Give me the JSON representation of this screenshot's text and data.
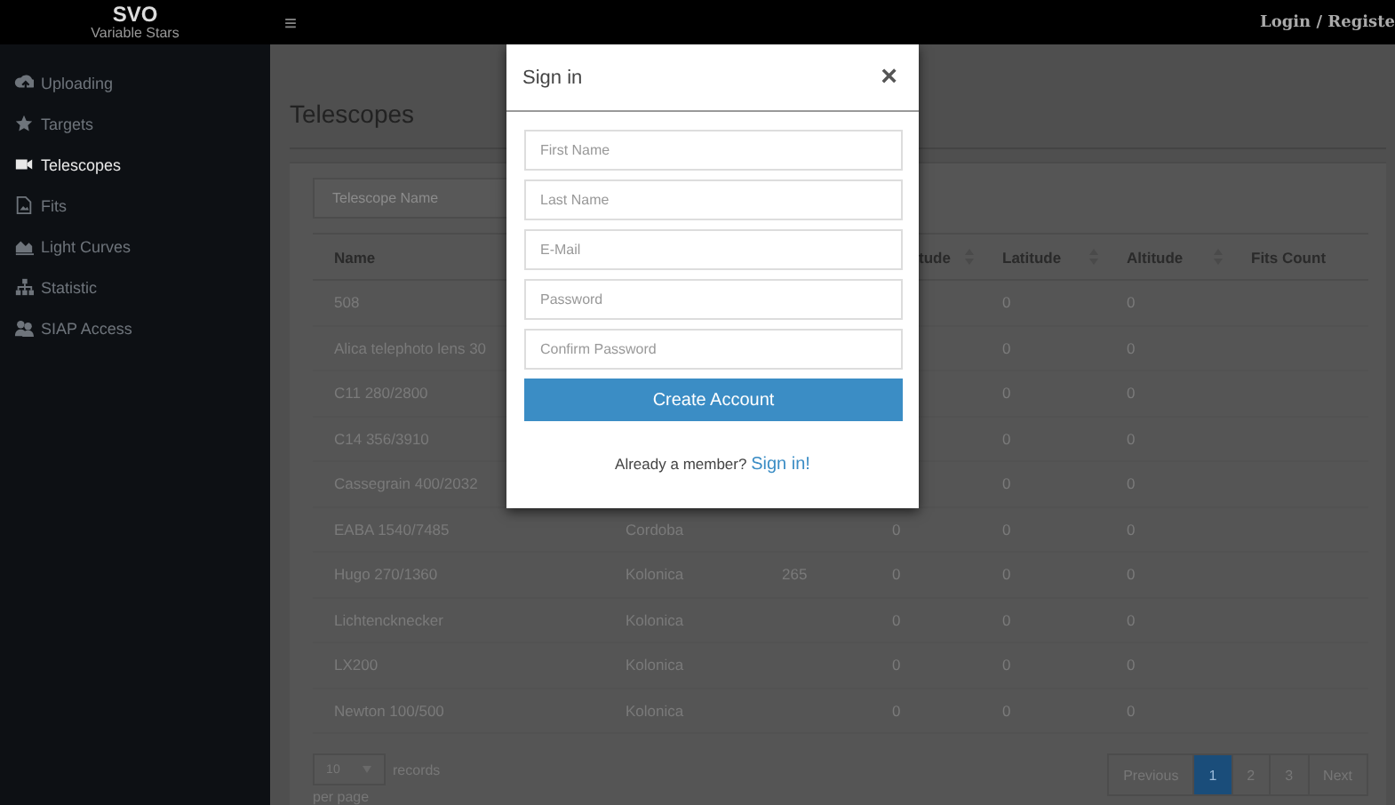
{
  "brand": {
    "title": "SVO",
    "subtitle": "Variable Stars"
  },
  "header": {
    "menu_icon": "≡",
    "auth_link": "Login / Registe"
  },
  "sidebar": {
    "items": [
      {
        "label": "Uploading",
        "selected": false
      },
      {
        "label": "Targets",
        "selected": false
      },
      {
        "label": "Telescopes",
        "selected": true
      },
      {
        "label": "Fits",
        "selected": false
      },
      {
        "label": "Light Curves",
        "selected": false
      },
      {
        "label": "Statistic",
        "selected": false
      },
      {
        "label": "SIAP Access",
        "selected": false
      }
    ]
  },
  "page": {
    "title": "Telescopes",
    "search": {
      "placeholder": "Telescope Name"
    },
    "table": {
      "columns": [
        "Name",
        null,
        null,
        "tude",
        "Latitude",
        "Altitude",
        "Fits Count"
      ],
      "rows": [
        [
          "508",
          null,
          null,
          null,
          "0",
          "0",
          null
        ],
        [
          "Alica telephoto lens 30",
          null,
          null,
          null,
          "0",
          "0",
          null
        ],
        [
          "C11 280/2800",
          null,
          null,
          null,
          "0",
          "0",
          null
        ],
        [
          "C14 356/3910",
          null,
          null,
          null,
          "0",
          "0",
          null
        ],
        [
          "Cassegrain 400/2032",
          null,
          null,
          null,
          "0",
          "0",
          null
        ],
        [
          "EABA 1540/7485",
          "Cordoba",
          null,
          "0",
          "0",
          "0",
          null
        ],
        [
          "Hugo 270/1360",
          "Kolonica",
          "265",
          "0",
          "0",
          "0",
          null
        ],
        [
          "Lichtencknecker",
          "Kolonica",
          null,
          "0",
          "0",
          "0",
          null
        ],
        [
          "LX200",
          "Kolonica",
          null,
          "0",
          "0",
          "0",
          null
        ],
        [
          "Newton 100/500",
          "Kolonica",
          null,
          "0",
          "0",
          "0",
          null
        ]
      ]
    },
    "page_size": {
      "value": "10",
      "label": "records",
      "label2": "per page"
    },
    "pagination": [
      {
        "label": "Previous",
        "selected": false
      },
      {
        "label": "1",
        "selected": true
      },
      {
        "label": "2",
        "selected": false
      },
      {
        "label": "3",
        "selected": false
      },
      {
        "label": "Next",
        "selected": false
      }
    ]
  },
  "modal": {
    "title": "Sign in",
    "close": "×",
    "fields": [
      {
        "placeholder": "First Name"
      },
      {
        "placeholder": "Last Name"
      },
      {
        "placeholder": "E-Mail"
      },
      {
        "placeholder": "Password"
      },
      {
        "placeholder": "Confirm Password"
      }
    ],
    "submit": "Create Account",
    "footer_text": "Already a member?",
    "footer_link": "Sign in!"
  }
}
